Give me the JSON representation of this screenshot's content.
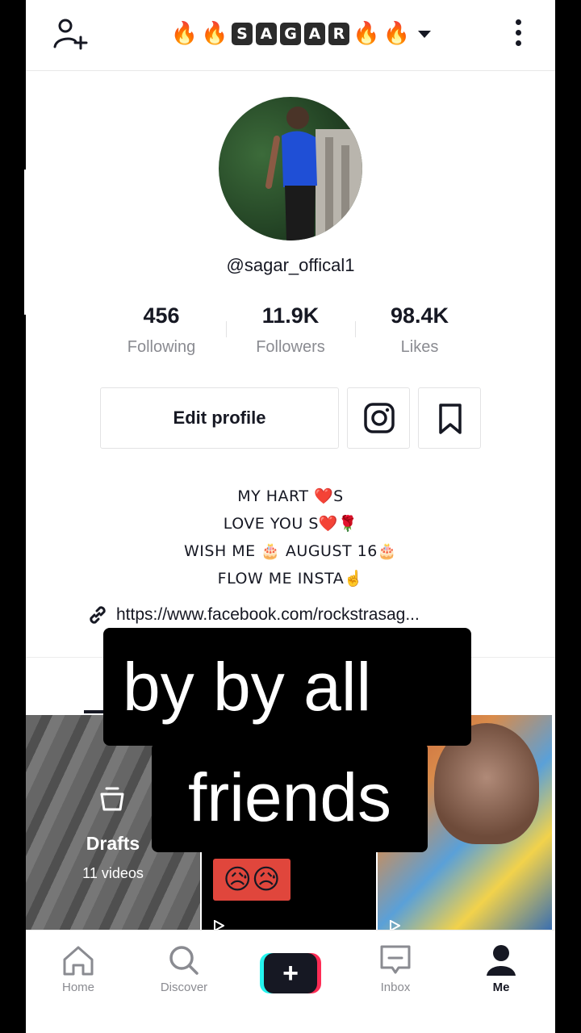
{
  "header": {
    "title_letters": [
      "S",
      "A",
      "G",
      "A",
      "R"
    ],
    "flame_emoji": "🔥"
  },
  "profile": {
    "username": "@sagar_offical1",
    "stats": [
      {
        "value": "456",
        "label": "Following"
      },
      {
        "value": "11.9K",
        "label": "Followers"
      },
      {
        "value": "98.4K",
        "label": "Likes"
      }
    ],
    "edit_profile_label": "Edit profile",
    "bio_lines": [
      "MY HART ❤️S",
      "LOVE YOU S❤️🌹",
      "WISH ME 🎂 AUGUST 16🎂",
      "FLOW ME INSTA☝️"
    ],
    "link": "https://www.facebook.com/rockstrasag..."
  },
  "grid": {
    "drafts_label": "Drafts",
    "drafts_count": "11 videos",
    "sad_emoji": "😥😥"
  },
  "caption": {
    "line1": "by by all",
    "line2": "friends"
  },
  "bottom_nav": {
    "home": "Home",
    "discover": "Discover",
    "create": "+",
    "inbox": "Inbox",
    "me": "Me"
  },
  "colors": {
    "text": "#161823",
    "secondary_text": "#8a8b91",
    "create_cyan": "#25f4ee",
    "create_pink": "#fe2c55"
  }
}
